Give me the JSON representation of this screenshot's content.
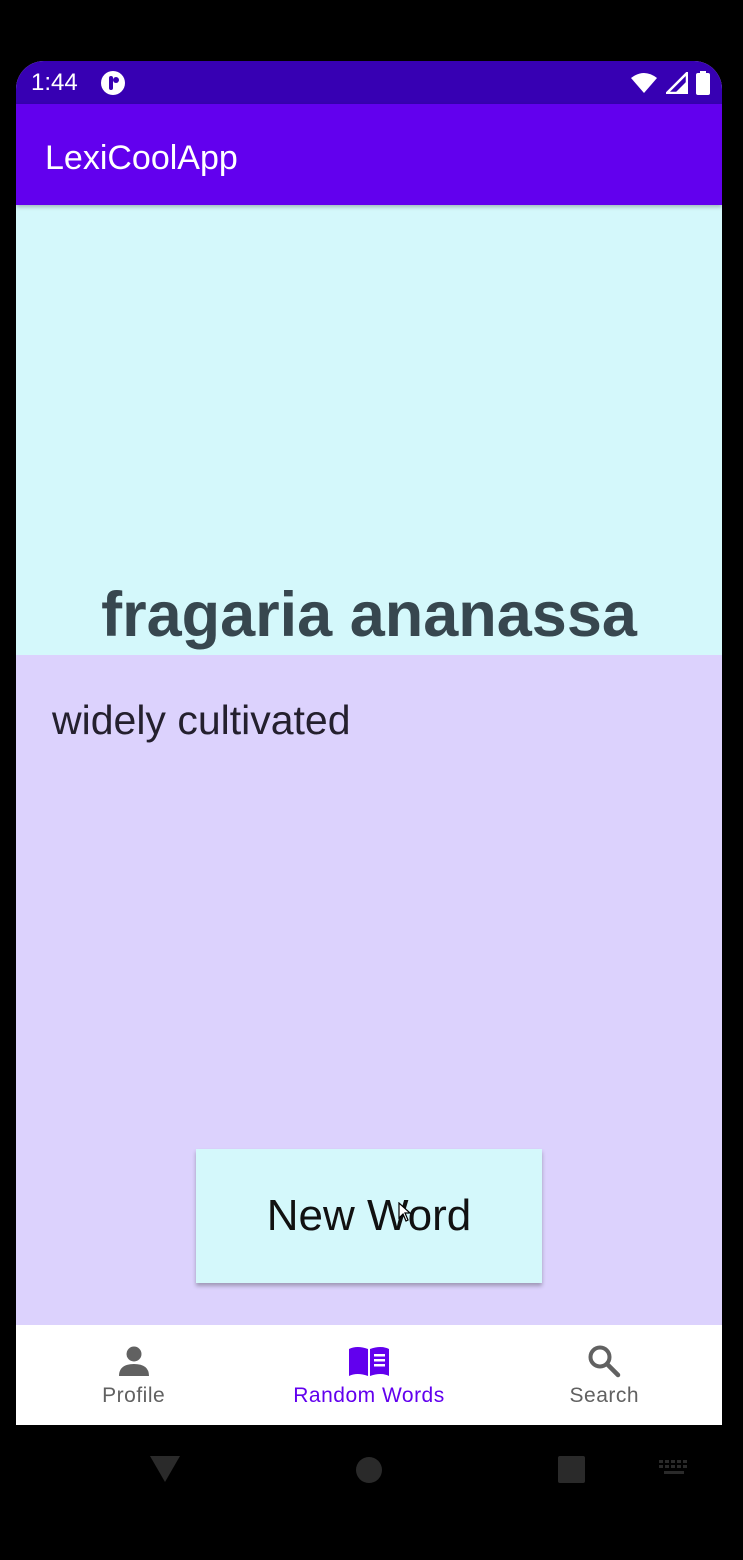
{
  "status_bar": {
    "time": "1:44",
    "icons": [
      "notification-icon",
      "wifi-icon",
      "signal-icon",
      "battery-icon"
    ]
  },
  "app_bar": {
    "title": "LexiCoolApp"
  },
  "word_card": {
    "word": "fragaria ananassa"
  },
  "definition": {
    "text": "widely cultivated"
  },
  "actions": {
    "new_word_label": "New Word"
  },
  "bottom_nav": {
    "items": [
      {
        "label": "Profile",
        "icon": "person-icon",
        "active": false
      },
      {
        "label": "Random Words",
        "icon": "book-icon",
        "active": true
      },
      {
        "label": "Search",
        "icon": "search-icon",
        "active": false
      }
    ]
  },
  "system_nav": {
    "icons": [
      "back-icon",
      "home-icon",
      "recents-icon",
      "keyboard-icon"
    ]
  },
  "colors": {
    "status_bar": "#3700b3",
    "app_bar": "#6200ee",
    "word_panel": "#d4f8fb",
    "definition_panel": "#dcd2fd",
    "active_nav": "#6200ee",
    "inactive_nav": "#616161"
  }
}
